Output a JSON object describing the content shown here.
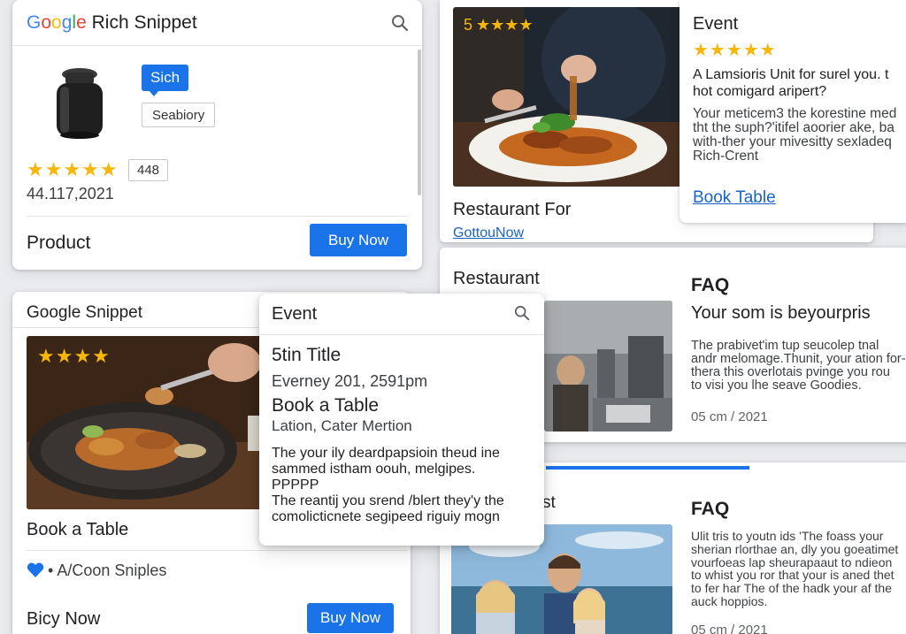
{
  "card1": {
    "google": [
      "G",
      "o",
      "o",
      "g",
      "l",
      "e"
    ],
    "google_colors": [
      "#4285F4",
      "#EA4335",
      "#FBBC05",
      "#4285F4",
      "#34A853",
      "#EA4335"
    ],
    "title": "Rich Snippet",
    "chip": "Sich",
    "tag": "Seabiory",
    "stars": "★★★★★",
    "rating_count": "448",
    "date": "44.117,2021",
    "product_label": "Product",
    "buy_label": "Buy Now"
  },
  "card2": {
    "badge_num": "5",
    "badge_stars": "★★★★",
    "title": "Restaurant For",
    "link": "GottouNow"
  },
  "card3": {
    "label": "Event",
    "stars": "★★★★★",
    "question": "A Lamsioris Unit for surel you. t hot comigard aripert?",
    "body_lines": [
      "Your meticem3 the korestine med",
      "tht the suph?'itifel aoorier ake, ba",
      "with-ther your mivesitty sexladeq",
      "Rich-Crent"
    ],
    "book_link": "Book Table"
  },
  "card4": {
    "label": "Restaurant",
    "faq": "FAQ",
    "headline": "Your som is beyourpris",
    "body_lines": [
      "The prabivet'im tup seucolep tnal",
      "andr melomage.Thunit, your ation for-",
      "thera this overlotais pvinge you rou",
      "to visi you lhe seave Goodies."
    ],
    "date": "05 cm / 2021"
  },
  "card5": {
    "title": "Google Snippet",
    "stars": "★★★★",
    "book": "Book a Table",
    "heart_label": "A/Coon Sniples",
    "bicy": "Bicy Now",
    "buy_label": "Buy Now"
  },
  "card6": {
    "label": "Event",
    "title": "5tin Title",
    "datetime": "Everney 201, 2591pm",
    "book": "Book a Table",
    "location": "Lation, Cater Mertion",
    "para1": [
      "The your ily deardpapsioin theud ine",
      "sammed istham oouh, melgipes.",
      "PPPPP"
    ],
    "para2": [
      "The reantij you srend /blert they'y the",
      "comolicticnete segipeed riguiy mogn"
    ]
  },
  "card7": {
    "st": "st",
    "faq": "FAQ",
    "body_lines": [
      "Ulit tris to youtn ids 'The foass your",
      "sherian rlorthae an, dly you goeatimet",
      "vourfoeas lap sheurapaaut to ndieon",
      "to whist you ror that your is aned thet",
      "to fer har The of the hadk your af the",
      "auck hoppios."
    ],
    "date": "05 cm / 2021"
  },
  "colors": {
    "accent": "#1a73e8",
    "star": "#f6b60a"
  }
}
